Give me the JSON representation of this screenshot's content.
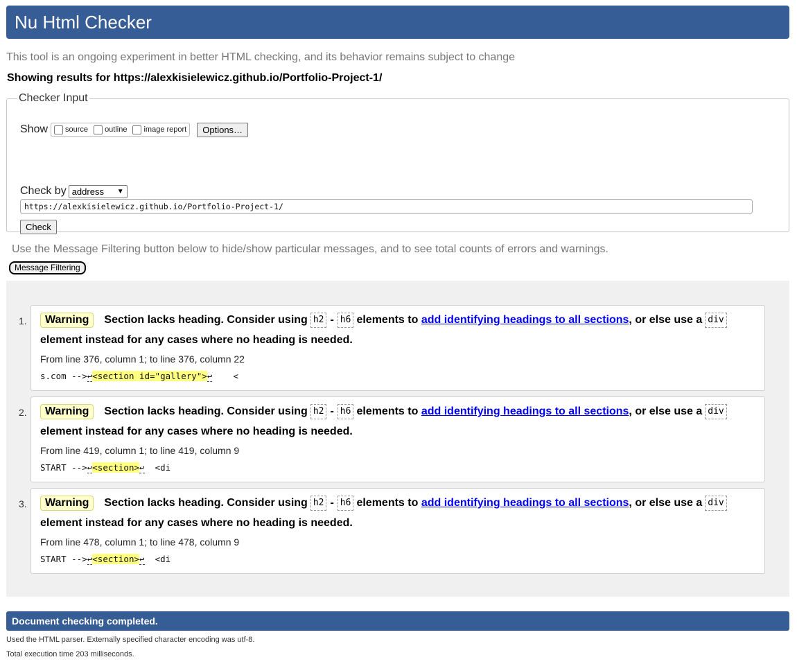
{
  "header": {
    "title": "Nu Html Checker"
  },
  "intro": {
    "tagline": "This tool is an ongoing experiment in better HTML checking, and its behavior remains subject to change",
    "showing": "Showing results for https://alexkisielewicz.github.io/Portfolio-Project-1/"
  },
  "checker_input": {
    "legend": "Checker Input",
    "show_label": "Show",
    "options": [
      {
        "label": "source",
        "checked": false
      },
      {
        "label": "outline",
        "checked": false
      },
      {
        "label": "image report",
        "checked": false
      }
    ],
    "options_button": "Options…",
    "check_by_label": "Check by",
    "check_by_value": "address",
    "url_value": "https://alexkisielewicz.github.io/Portfolio-Project-1/",
    "check_button": "Check"
  },
  "filter": {
    "hint": "Use the Message Filtering button below to hide/show particular messages, and to see total counts of errors and warnings.",
    "button": "Message Filtering"
  },
  "messages": [
    {
      "num": "1.",
      "type": "Warning",
      "text_a": "Section lacks heading. Consider using",
      "code1": "h2",
      "dash": "-",
      "code2": "h6",
      "text_b": "elements to",
      "link": "add identifying headings to all sections",
      "text_c": ", or else use a",
      "code3": "div",
      "text_d": "element instead for any cases where no heading is needed.",
      "location": "From line 376, column 1; to line 376, column 22",
      "ext_pre": "s.com -->",
      "ret1": "↩",
      "highlight": "<section id=\"gallery\">",
      "ret2": "↩",
      "ext_post": "    <"
    },
    {
      "num": "2.",
      "type": "Warning",
      "text_a": "Section lacks heading. Consider using",
      "code1": "h2",
      "dash": "-",
      "code2": "h6",
      "text_b": "elements to",
      "link": "add identifying headings to all sections",
      "text_c": ", or else use a",
      "code3": "div",
      "text_d": "element instead for any cases where no heading is needed.",
      "location": "From line 419, column 1; to line 419, column 9",
      "ext_pre": "START -->",
      "ret1": "↩",
      "highlight": "<section>",
      "ret2": "↩",
      "ext_post": "  <di"
    },
    {
      "num": "3.",
      "type": "Warning",
      "text_a": "Section lacks heading. Consider using",
      "code1": "h2",
      "dash": "-",
      "code2": "h6",
      "text_b": "elements to",
      "link": "add identifying headings to all sections",
      "text_c": ", or else use a",
      "code3": "div",
      "text_d": "element instead for any cases where no heading is needed.",
      "location": "From line 478, column 1; to line 478, column 9",
      "ext_pre": "START -->",
      "ret1": "↩",
      "highlight": "<section>",
      "ret2": "↩",
      "ext_post": "  <di"
    }
  ],
  "footer": {
    "status": "Document checking completed.",
    "parser_note": "Used the HTML parser. Externally specified character encoding was utf-8.",
    "timing": "Total execution time 203 milliseconds."
  },
  "colors": {
    "header_bg": "#365d95",
    "warning_bg": "#ffffcc",
    "highlight": "#ffff80",
    "link": "#0000ee"
  }
}
